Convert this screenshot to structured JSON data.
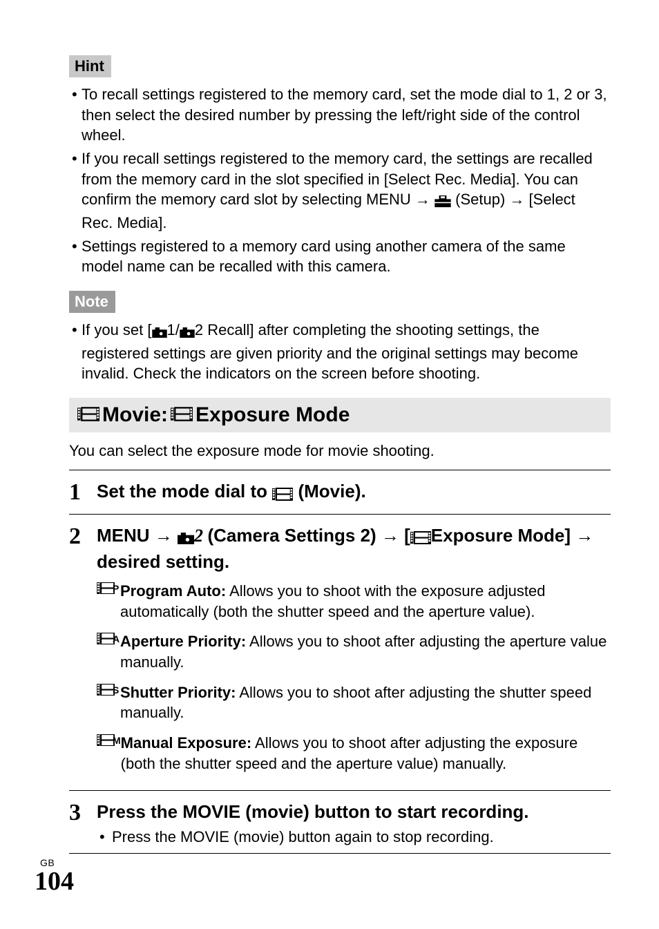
{
  "hint": {
    "label": "Hint",
    "items": [
      "To recall settings registered to the memory card, set the mode dial to 1, 2 or 3, then select the desired number by pressing the left/right side of the control wheel.",
      "If you recall settings registered to the memory card, the settings are recalled from the memory card in the slot specified in [Select Rec. Media]. You can confirm the memory card slot by selecting MENU → {TOOLBOX} (Setup) → [Select Rec. Media].",
      "Settings registered to a memory card using another camera of the same model name can be recalled with this camera."
    ]
  },
  "note": {
    "label": "Note",
    "items": [
      "If you set [{CAM}1/{CAM}2 Recall] after completing the shooting settings, the registered settings are given priority and the original settings may become invalid. Check the indicators on the screen before shooting."
    ]
  },
  "section": {
    "titleA": "Movie:",
    "titleB": "Exposure Mode",
    "lead": "You can select the exposure mode for movie shooting."
  },
  "steps": {
    "s1": {
      "num": "1",
      "head_pre": "Set the mode dial to ",
      "head_post": "(Movie)."
    },
    "s2": {
      "num": "2",
      "head_pre": "MENU → ",
      "head_mid": "(Camera Settings 2) → [",
      "head_post": "Exposure Mode] → desired setting.",
      "modes": [
        {
          "sub": "P",
          "name": "Program Auto:",
          "desc": " Allows you to shoot with the exposure adjusted automatically (both the shutter speed and the aperture value)."
        },
        {
          "sub": "A",
          "name": "Aperture Priority:",
          "desc": " Allows you to shoot after adjusting the aperture value manually."
        },
        {
          "sub": "S",
          "name": "Shutter Priority:",
          "desc": " Allows you to shoot after adjusting the shutter speed manually."
        },
        {
          "sub": "M",
          "name": "Manual Exposure:",
          "desc": " Allows you to shoot after adjusting the exposure (both the shutter speed and the aperture value) manually."
        }
      ]
    },
    "s3": {
      "num": "3",
      "head": "Press the MOVIE (movie) button to start recording.",
      "sub": "Press the MOVIE (movie) button again to stop recording."
    }
  },
  "footer": {
    "gb": "GB",
    "page": "104"
  }
}
